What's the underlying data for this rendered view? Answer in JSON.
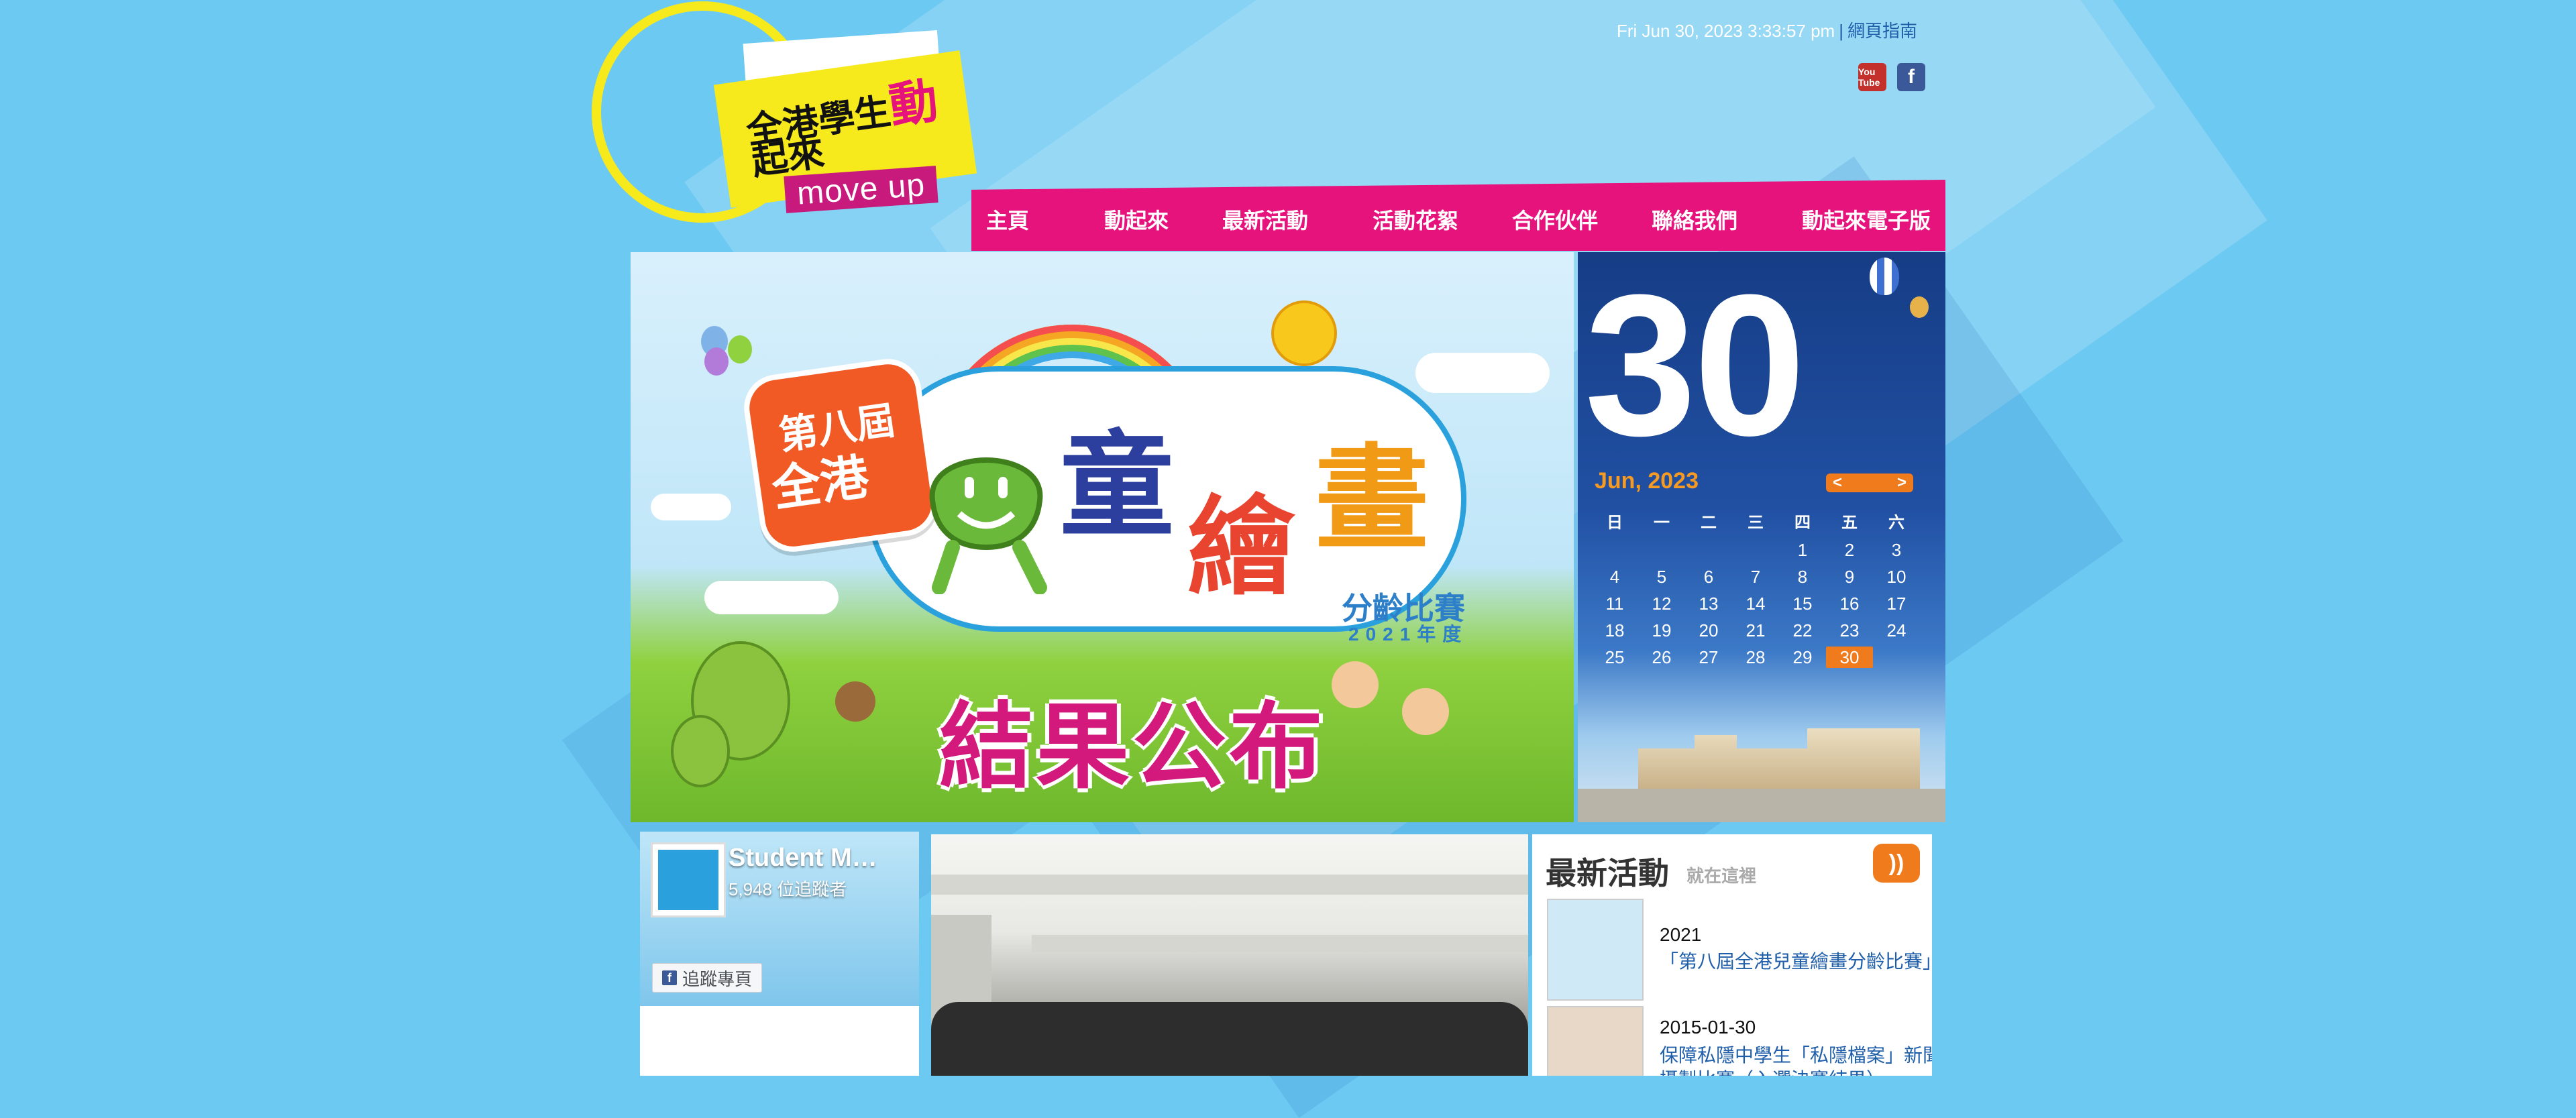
{
  "header": {
    "datetime": "Fri Jun 30, 2023 3:33:57 pm",
    "separator": "|",
    "sitemap": "網頁指南",
    "youtube_icon_label": "You Tube",
    "facebook_icon_label": "f"
  },
  "logo": {
    "line1_main": "全港學生",
    "line1_accent": "動",
    "line2": "起來",
    "tagline": "move up"
  },
  "nav": [
    {
      "label": "主頁"
    },
    {
      "label": "動起來"
    },
    {
      "label": "最新活動"
    },
    {
      "label": "活動花絮"
    },
    {
      "label": "合作伙伴"
    },
    {
      "label": "聯絡我們"
    },
    {
      "label": "動起來電子版"
    }
  ],
  "banner": {
    "badge_line1": "第八屆",
    "badge_line2": "全港",
    "title_char1": "童",
    "title_char2": "繪",
    "title_char3": "畫",
    "subtitle": "分齡比賽",
    "year": "2021年度",
    "result": "結果公布"
  },
  "calendar": {
    "day": "30",
    "month_year": "Jun, 2023",
    "prev": "<",
    "next": ">",
    "weekdays": [
      "日",
      "一",
      "二",
      "三",
      "四",
      "五",
      "六"
    ],
    "weeks": [
      [
        "",
        "",
        "",
        "",
        "1",
        "2",
        "3"
      ],
      [
        "4",
        "5",
        "6",
        "7",
        "8",
        "9",
        "10"
      ],
      [
        "11",
        "12",
        "13",
        "14",
        "15",
        "16",
        "17"
      ],
      [
        "18",
        "19",
        "20",
        "21",
        "22",
        "23",
        "24"
      ],
      [
        "25",
        "26",
        "27",
        "28",
        "29",
        "30",
        ""
      ]
    ],
    "today": "30"
  },
  "facebook_box": {
    "page_name": "Student M…",
    "followers": "5,948 位追蹤者",
    "follow_button": "追蹤專頁"
  },
  "news": {
    "title": "最新活動",
    "subtitle": "就在這裡",
    "rss_icon": "rss",
    "items": [
      {
        "date": "2021",
        "title": "「第八屆全港兒童繪畫分齡比賽」"
      },
      {
        "date": "2015-01-30",
        "title": "保障私隱中學生「私隱檔案」新聞",
        "title2": "攝製比賽（入選決賽結果）"
      }
    ]
  },
  "colors": {
    "background": "#6cc9f2",
    "nav": "#e6137d",
    "accent_orange": "#f07b1c",
    "link": "#1f5ea8"
  }
}
